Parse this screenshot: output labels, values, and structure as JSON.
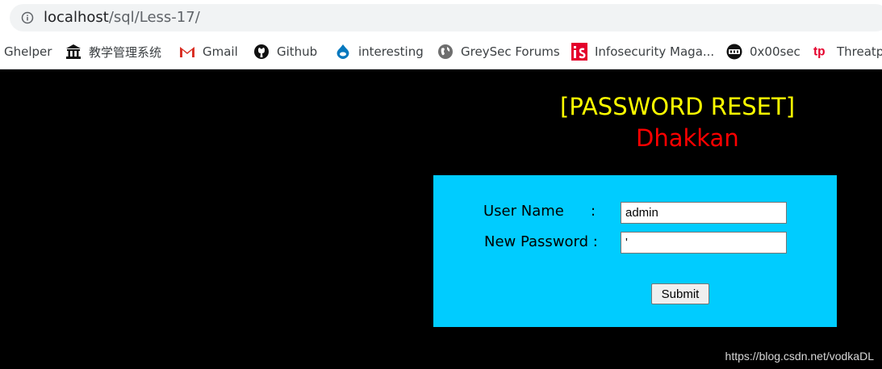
{
  "browser": {
    "url_host": "localhost",
    "url_path": "/sql/Less-17/",
    "bookmarks": [
      {
        "label": "Ghelper",
        "icon": "none"
      },
      {
        "label": "教学管理系统",
        "icon": "building-icon"
      },
      {
        "label": "Gmail",
        "icon": "gmail-icon"
      },
      {
        "label": "Github",
        "icon": "github-icon"
      },
      {
        "label": "interesting",
        "icon": "drupal-icon"
      },
      {
        "label": "GreySec Forums",
        "icon": "globe-icon"
      },
      {
        "label": "Infosecurity Maga...",
        "icon": "infosecurity-icon"
      },
      {
        "label": "0x00sec",
        "icon": "0x00sec-icon"
      },
      {
        "label": "Threatp",
        "icon": "threatpost-icon"
      }
    ]
  },
  "page": {
    "title": "[PASSWORD RESET]",
    "subtitle": "Dhakkan",
    "form": {
      "username_label": "User Name",
      "username_colon": ":",
      "username_value": "admin",
      "password_label": "New Password :",
      "password_value": "'",
      "submit_label": "Submit"
    },
    "watermark": "https://blog.csdn.net/vodkaDL"
  },
  "colors": {
    "title": "#ffff00",
    "subtitle": "#ff0000",
    "form_bg": "#00ccff",
    "page_bg": "#000000"
  }
}
